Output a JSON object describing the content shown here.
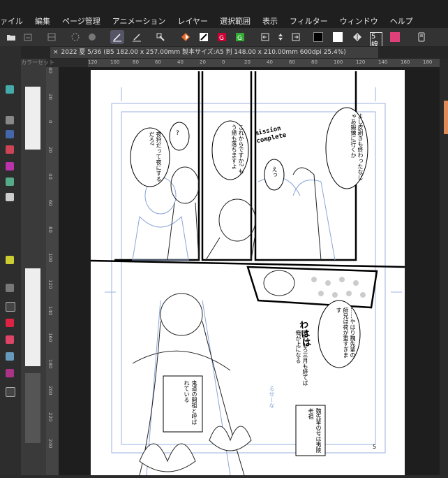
{
  "menu": [
    "ァイル",
    "編集",
    "ページ管理",
    "アニメーション",
    "レイヤー",
    "選択範囲",
    "表示",
    "フィルター",
    "ウィンドウ",
    "ヘルプ"
  ],
  "toolbar": {
    "line_width_label": "5線",
    "color_main": "#000000",
    "color_sub": "#ffffff",
    "accent_pink": "#e0407a"
  },
  "document_tab": {
    "close": "×",
    "title": "2022 夏 5/36 (B5 182.00 x 257.00mm 製本サイズ:A5 判 148.00 x 210.00mm 600dpi 25.4%)"
  },
  "panel": {
    "color_set_label": "カラーセット"
  },
  "ruler_top_ticks": [
    "120",
    "100",
    "80",
    "60",
    "40",
    "20",
    "0",
    "20",
    "40",
    "60",
    "80",
    "100",
    "120",
    "140",
    "160",
    "180"
  ],
  "ruler_left_ticks": [
    "40",
    "20",
    "0",
    "20",
    "40",
    "60",
    "80",
    "100",
    "120",
    "140",
    "160",
    "180",
    "200",
    "220",
    "240"
  ],
  "manga": {
    "bubble_left": "夜狩だって夜にするだろ?",
    "bubble_q": "?",
    "bubble_mid": "これからですか? もう帰も落ちますよ",
    "stamp": "mission complete",
    "bubble_right": "よし皮剥きも終わったなじゃあ鍛錬に行くか",
    "bubble_small": "えっ",
    "bubble_lower_right": "……やはり魏先輩の師兄は荷が重すぎます",
    "sfx": "わはは",
    "handwritten": "安心しろ三月も経てば俺が上になる",
    "caption_center": "鬼道の開祖と呼ばれている",
    "caption_right": "魏先輩の号は夷陵老祖",
    "small_sfx": "るせーな",
    "page_number": "5"
  }
}
